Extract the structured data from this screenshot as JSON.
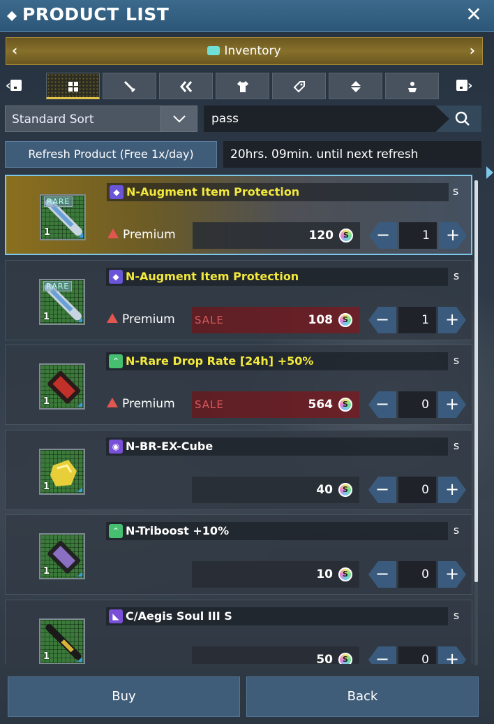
{
  "window": {
    "title": "PRODUCT LIST",
    "close_glyph": "✕"
  },
  "category": {
    "label": "Inventory",
    "prev_glyph": "‹",
    "next_glyph": "›",
    "icon": "inventory-chip-icon"
  },
  "tabs": [
    {
      "name": "all",
      "icon": "grid-icon",
      "active": true
    },
    {
      "name": "weapons",
      "icon": "sword-icon",
      "active": false
    },
    {
      "name": "units",
      "icon": "double-chevron-icon",
      "active": false
    },
    {
      "name": "costumes",
      "icon": "shirt-icon",
      "active": false
    },
    {
      "name": "tags",
      "icon": "tag-icon",
      "active": false
    },
    {
      "name": "items",
      "icon": "capsule-icon",
      "active": false
    },
    {
      "name": "rooms",
      "icon": "mannequin-icon",
      "active": false
    }
  ],
  "sort": {
    "label": "Standard Sort"
  },
  "search": {
    "value": "pass"
  },
  "refresh": {
    "button_label": "Refresh Product (Free 1x/day)",
    "info": "20hrs. 09min. until next refresh"
  },
  "items": [
    {
      "name": "N-Augment Item Protection",
      "name_color": "#f3e93c",
      "type_icon_color": "#6a55d8",
      "badge": "RARE",
      "qty": "1",
      "currency": "Premium",
      "sale": false,
      "price": "120",
      "count": "1"
    },
    {
      "name": "N-Augment Item Protection",
      "name_color": "#f3e93c",
      "type_icon_color": "#6a55d8",
      "badge": "RARE",
      "qty": "1",
      "currency": "Premium",
      "sale": true,
      "sale_label": "SALE",
      "price": "108",
      "count": "1"
    },
    {
      "name": "N-Rare Drop Rate [24h] +50%",
      "name_color": "#f3e93c",
      "type_icon_color": "#46c070",
      "badge": "",
      "qty": "1",
      "currency": "Premium",
      "sale": true,
      "sale_label": "SALE",
      "price": "564",
      "count": "0"
    },
    {
      "name": "N-BR-EX-Cube",
      "name_color": "#ffffff",
      "type_icon_color": "#7a4fd8",
      "badge": "",
      "qty": "1",
      "currency": "",
      "sale": false,
      "price": "40",
      "count": "0"
    },
    {
      "name": "N-Triboost +10%",
      "name_color": "#ffffff",
      "type_icon_color": "#46c070",
      "badge": "",
      "qty": "1",
      "currency": "",
      "sale": false,
      "price": "10",
      "count": "0"
    },
    {
      "name": "C/Aegis Soul III S",
      "name_color": "#ffffff",
      "type_icon_color": "#7a4fd8",
      "badge": "",
      "qty": "1",
      "currency": "",
      "sale": false,
      "price": "50",
      "count": "0"
    }
  ],
  "coin_glyph": "S",
  "stepper": {
    "minus": "−",
    "plus": "+"
  },
  "footer": {
    "buy_label": "Buy",
    "back_label": "Back"
  }
}
